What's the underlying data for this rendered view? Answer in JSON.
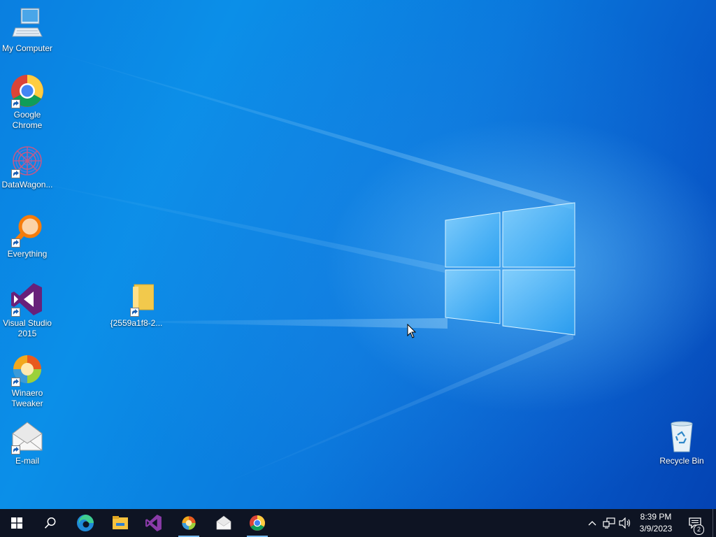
{
  "desktop": {
    "icons": [
      {
        "name": "my-computer",
        "label": "My Computer",
        "icon": "computer-icon",
        "shortcut": false
      },
      {
        "name": "google-chrome",
        "label": "Google Chrome",
        "icon": "chrome-icon",
        "shortcut": true
      },
      {
        "name": "datawagon",
        "label": "DataWagon...",
        "icon": "datawagon-icon",
        "shortcut": true
      },
      {
        "name": "everything",
        "label": "Everything",
        "icon": "everything-search-icon",
        "shortcut": true
      },
      {
        "name": "visual-studio-2015",
        "label": "Visual Studio 2015",
        "icon": "visual-studio-icon",
        "shortcut": true
      },
      {
        "name": "winaero-tweaker",
        "label": "Winaero Tweaker",
        "icon": "winaero-icon",
        "shortcut": true
      },
      {
        "name": "email",
        "label": "E-mail",
        "icon": "mail-envelope-icon",
        "shortcut": true
      },
      {
        "name": "folder-shortcut",
        "label": "{2559a1f8-2...",
        "icon": "folder-icon",
        "shortcut": true
      },
      {
        "name": "recycle-bin",
        "label": "Recycle Bin",
        "icon": "recycle-bin-icon",
        "shortcut": false
      }
    ]
  },
  "taskbar": {
    "start": "windows-start-icon",
    "search": "search-icon",
    "pinned": [
      {
        "name": "edge",
        "icon": "edge-icon",
        "running": false
      },
      {
        "name": "file-explorer",
        "icon": "file-explorer-icon",
        "running": false
      },
      {
        "name": "visual-studio",
        "icon": "visual-studio-icon",
        "running": false
      },
      {
        "name": "winaero-tweaker",
        "icon": "winaero-icon",
        "running": true
      },
      {
        "name": "mail",
        "icon": "mail-envelope-icon",
        "running": false
      },
      {
        "name": "chrome",
        "icon": "chrome-icon",
        "running": true
      }
    ],
    "tray": {
      "icons": [
        "chevron-up-icon",
        "network-icon",
        "volume-icon"
      ],
      "time": "8:39 PM",
      "date": "3/9/2023",
      "notification_count": "2"
    }
  },
  "colors": {
    "taskbar": "#0e1423",
    "running_indicator": "#76b9ed",
    "wallpaper_blue": "#0a7fe0"
  }
}
